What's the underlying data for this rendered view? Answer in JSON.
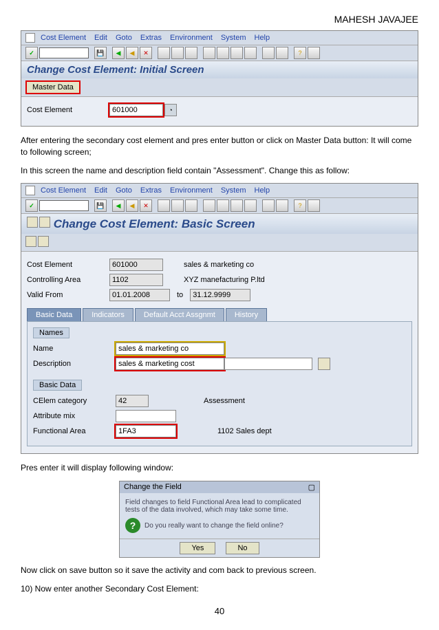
{
  "header": {
    "author": "MAHESH JAVAJEE"
  },
  "menu": {
    "m1": "Cost Element",
    "m2": "Edit",
    "m3": "Goto",
    "m4": "Extras",
    "m5": "Environment",
    "m6": "System",
    "m7": "Help"
  },
  "screen1": {
    "title": "Change Cost Element: Initial Screen",
    "masterData": "Master Data",
    "label_ce": "Cost Element",
    "val_ce": "601000"
  },
  "text1": "After entering the secondary cost element and pres enter button or  click on Master Data button: It will come to following screen;",
  "text2": "In this screen the name and description field contain \"Assessment\". Change this as follow:",
  "screen2": {
    "title": "Change Cost Element: Basic Screen",
    "label_ce": "Cost Element",
    "val_ce": "601000",
    "desc_ce": "sales & marketing co",
    "label_ca": "Controlling Area",
    "val_ca": "1102",
    "desc_ca": "XYZ manefacturing P.ltd",
    "label_vf": "Valid From",
    "val_vf": "01.01.2008",
    "label_to": "to",
    "val_to": "31.12.9999",
    "tabs": {
      "t1": "Basic Data",
      "t2": "Indicators",
      "t3": "Default Acct Assgnmt",
      "t4": "History"
    },
    "group_names": "Names",
    "label_name": "Name",
    "val_name": "sales & marketing co",
    "label_desc": "Description",
    "val_desc": "sales & marketing cost",
    "group_basic": "Basic Data",
    "label_cat": "CElem category",
    "val_cat": "42",
    "desc_cat": "Assessment",
    "label_attr": "Attribute mix",
    "label_fa": "Functional Area",
    "val_fa": "1FA3",
    "desc_fa": "1102 Sales dept"
  },
  "text3": "Pres enter it will display following window:",
  "dialog": {
    "title": "Change the Field",
    "body1": "Field changes to field Functional Area lead to complicated tests of the data involved, which may take some time.",
    "body2": "Do you really want to change the field online?",
    "yes": "Yes",
    "no": "No"
  },
  "text4": "Now click on save button so it save the activity and com back to previous screen.",
  "text5": "10) Now enter another Secondary Cost Element:",
  "pagenum": "40"
}
